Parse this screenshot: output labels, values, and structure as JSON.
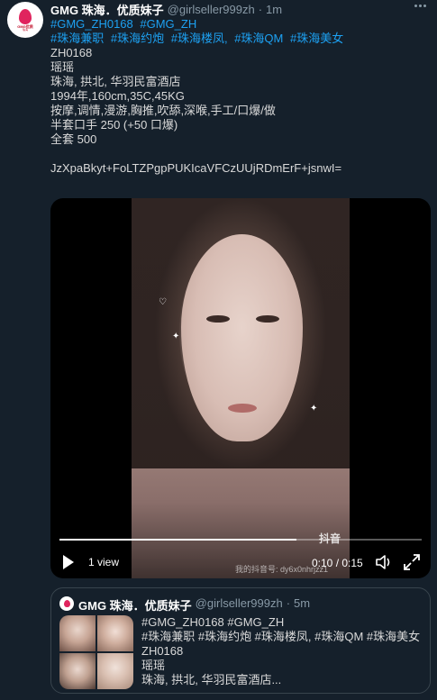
{
  "tweet": {
    "account_name": "GMG 珠海．优质妹子",
    "handle": "@girlseller999zh",
    "separator": "·",
    "time": "1m",
    "avatar_text_line1": "GMG优质",
    "avatar_text_line2": "珠海",
    "hashtag_line_1": [
      "#GMG_ZH0168",
      "#GMG_ZH"
    ],
    "hashtag_line_2": [
      "#珠海兼职",
      "#珠海约炮",
      "#珠海楼凤,",
      "#珠海QM",
      "#珠海美女"
    ],
    "lines": [
      "ZH0168",
      "瑶瑶",
      "珠海, 拱北, 华羽民富酒店",
      "1994年,160cm,35C,45KG",
      "按摩,调情,漫游,胸推,吹舔,深喉,手工/口爆/做",
      "半套口手 250 (+50 口爆)",
      "全套 500"
    ],
    "code": "JzXpaBkyt+FoLTZPgpPUKIcaVFCzUUjRDmErF+jsnwI="
  },
  "video": {
    "progress": 0.655,
    "views": "1 view",
    "time": "0:10 / 0:15",
    "watermark": "抖音",
    "watermark_id": "我的抖音号: dy6x0nhrjzz1"
  },
  "quote": {
    "account_name": "GMG 珠海．优质妹子",
    "handle": "@girlseller999zh",
    "separator": "·",
    "time": "5m",
    "lines": [
      "#GMG_ZH0168 #GMG_ZH",
      "#珠海兼职 #珠海约炮 #珠海楼凤, #珠海QM #珠海美女",
      "ZH0168",
      "瑶瑶",
      "珠海, 拱北, 华羽民富酒店..."
    ]
  },
  "colors": {
    "background": "#15202b",
    "link": "#1da1f2",
    "secondary_text": "#8899a6",
    "border": "#38444d"
  }
}
